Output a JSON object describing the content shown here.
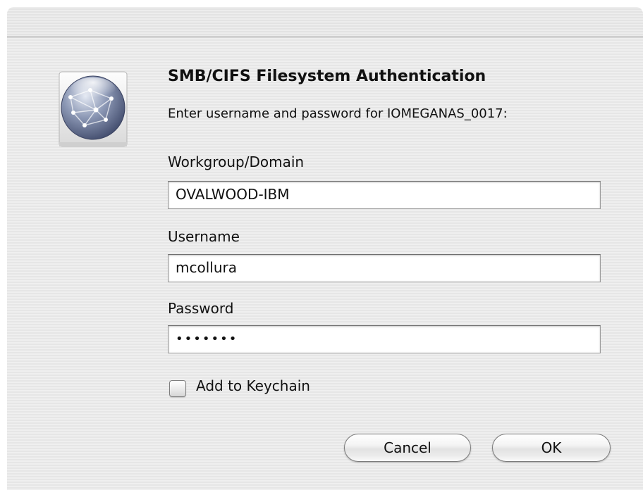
{
  "dialog": {
    "heading": "SMB/CIFS Filesystem Authentication",
    "message": "Enter username and password for IOMEGANAS_0017:",
    "icon": "network-globe-icon"
  },
  "fields": {
    "workgroup": {
      "label": "Workgroup/Domain",
      "value": "OVALWOOD-IBM"
    },
    "username": {
      "label": "Username",
      "value": "mcollura"
    },
    "password": {
      "label": "Password",
      "value": "•••••••"
    }
  },
  "keychain": {
    "label": "Add to Keychain",
    "checked": false
  },
  "buttons": {
    "cancel": "Cancel",
    "ok": "OK"
  }
}
